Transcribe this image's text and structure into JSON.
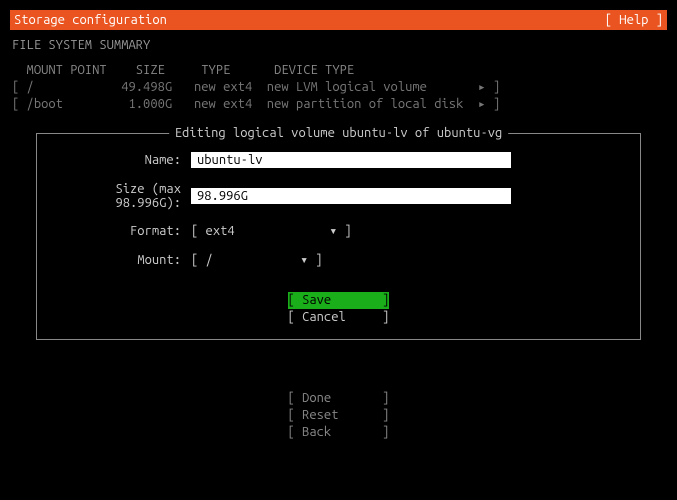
{
  "header": {
    "title": "Storage configuration",
    "help": "[ Help ]"
  },
  "section_title": "FILE SYSTEM SUMMARY",
  "summary": {
    "headers": "  MOUNT POINT    SIZE     TYPE      DEVICE TYPE",
    "rows": [
      "[ /            49.498G   new ext4  new LVM logical volume       ▸ ]",
      "[ /boot         1.000G   new ext4  new partition of local disk  ▸ ]"
    ]
  },
  "dialog": {
    "title": " Editing logical volume ubuntu-lv of ubuntu-vg ",
    "name_label": "Name:",
    "name_value": "ubuntu-lv",
    "size_label": "Size (max 98.996G):",
    "size_value": "98.996G",
    "format_label": "Format:",
    "format_select": "[ ext4             ▾ ]",
    "mount_label": "Mount:",
    "mount_select": "[ /            ▾ ]",
    "save": "[ Save       ]",
    "cancel": "[ Cancel     ]"
  },
  "footer": {
    "done": "[ Done       ]",
    "reset": "[ Reset      ]",
    "back": "[ Back       ]"
  }
}
